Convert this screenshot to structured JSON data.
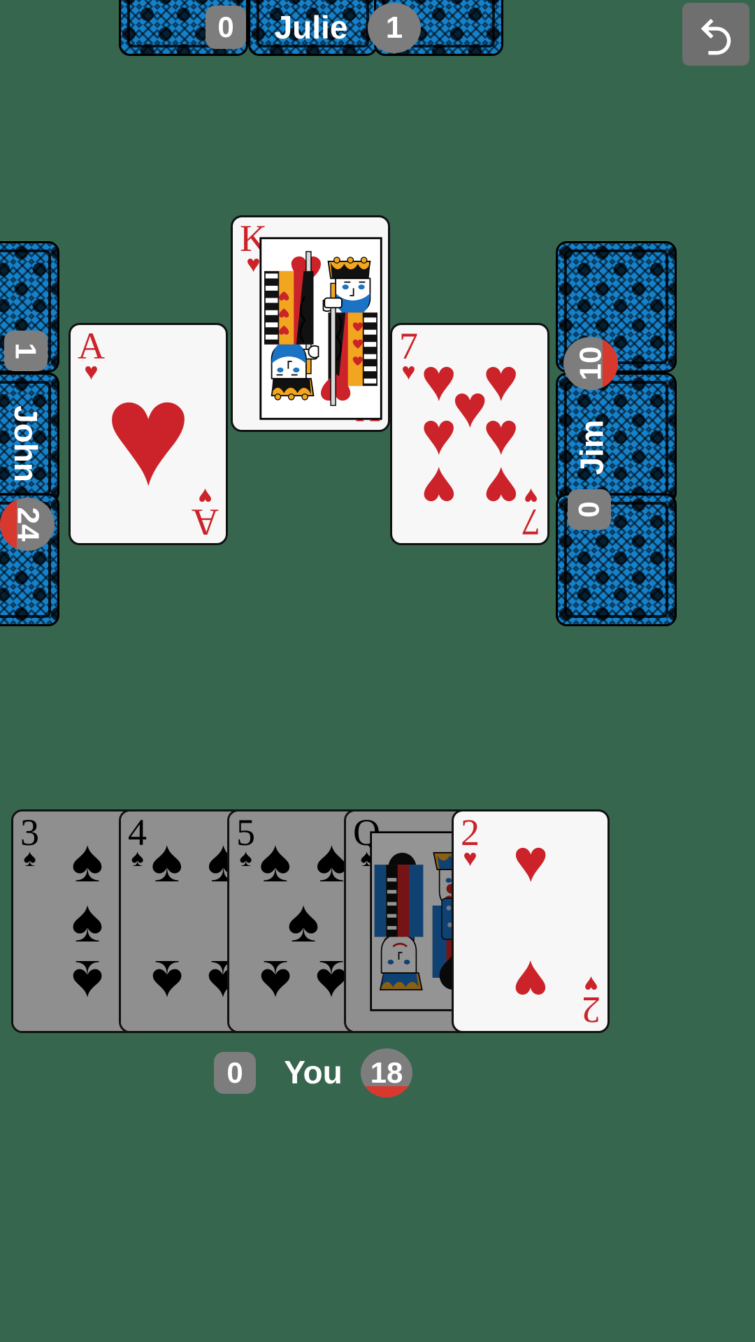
{
  "table": {
    "felt_color": "#37664f",
    "card_back_color": "#1581ca",
    "badge_color": "#7d7d7d",
    "accent_red": "#d8392f"
  },
  "toolbar": {
    "undo_label": "↺",
    "undo_icon": "undo-arrow-icon"
  },
  "players": {
    "top": {
      "name": "Julie",
      "tricks": "0",
      "score": "1",
      "hand_card_count": 3,
      "position": "top"
    },
    "left": {
      "name": "John",
      "tricks": "1",
      "score": "24",
      "hand_card_count": 3,
      "position": "left"
    },
    "right": {
      "name": "Jim",
      "tricks": "0",
      "score": "10",
      "hand_card_count": 3,
      "position": "right"
    },
    "bottom": {
      "name": "You",
      "tricks": "0",
      "score": "18",
      "position": "bottom"
    }
  },
  "trick": {
    "cards": [
      {
        "slot": "left",
        "rank": "A",
        "suit": "hearts",
        "suit_symbol": "♥",
        "color": "red",
        "player": "John"
      },
      {
        "slot": "top",
        "rank": "K",
        "suit": "hearts",
        "suit_symbol": "♥",
        "color": "red",
        "player": "Julie",
        "face_card": true
      },
      {
        "slot": "right",
        "rank": "7",
        "suit": "hearts",
        "suit_symbol": "♥",
        "color": "red",
        "player": "Jim"
      }
    ]
  },
  "hand": {
    "cards": [
      {
        "rank": "3",
        "suit": "spades",
        "suit_symbol": "♠",
        "color": "black",
        "playable": false
      },
      {
        "rank": "4",
        "suit": "spades",
        "suit_symbol": "♠",
        "color": "black",
        "playable": false
      },
      {
        "rank": "5",
        "suit": "spades",
        "suit_symbol": "♠",
        "color": "black",
        "playable": false
      },
      {
        "rank": "Q",
        "suit": "spades",
        "suit_symbol": "♠",
        "color": "black",
        "playable": false,
        "face_card": true
      },
      {
        "rank": "2",
        "suit": "hearts",
        "suit_symbol": "♥",
        "color": "red",
        "playable": true
      }
    ]
  }
}
